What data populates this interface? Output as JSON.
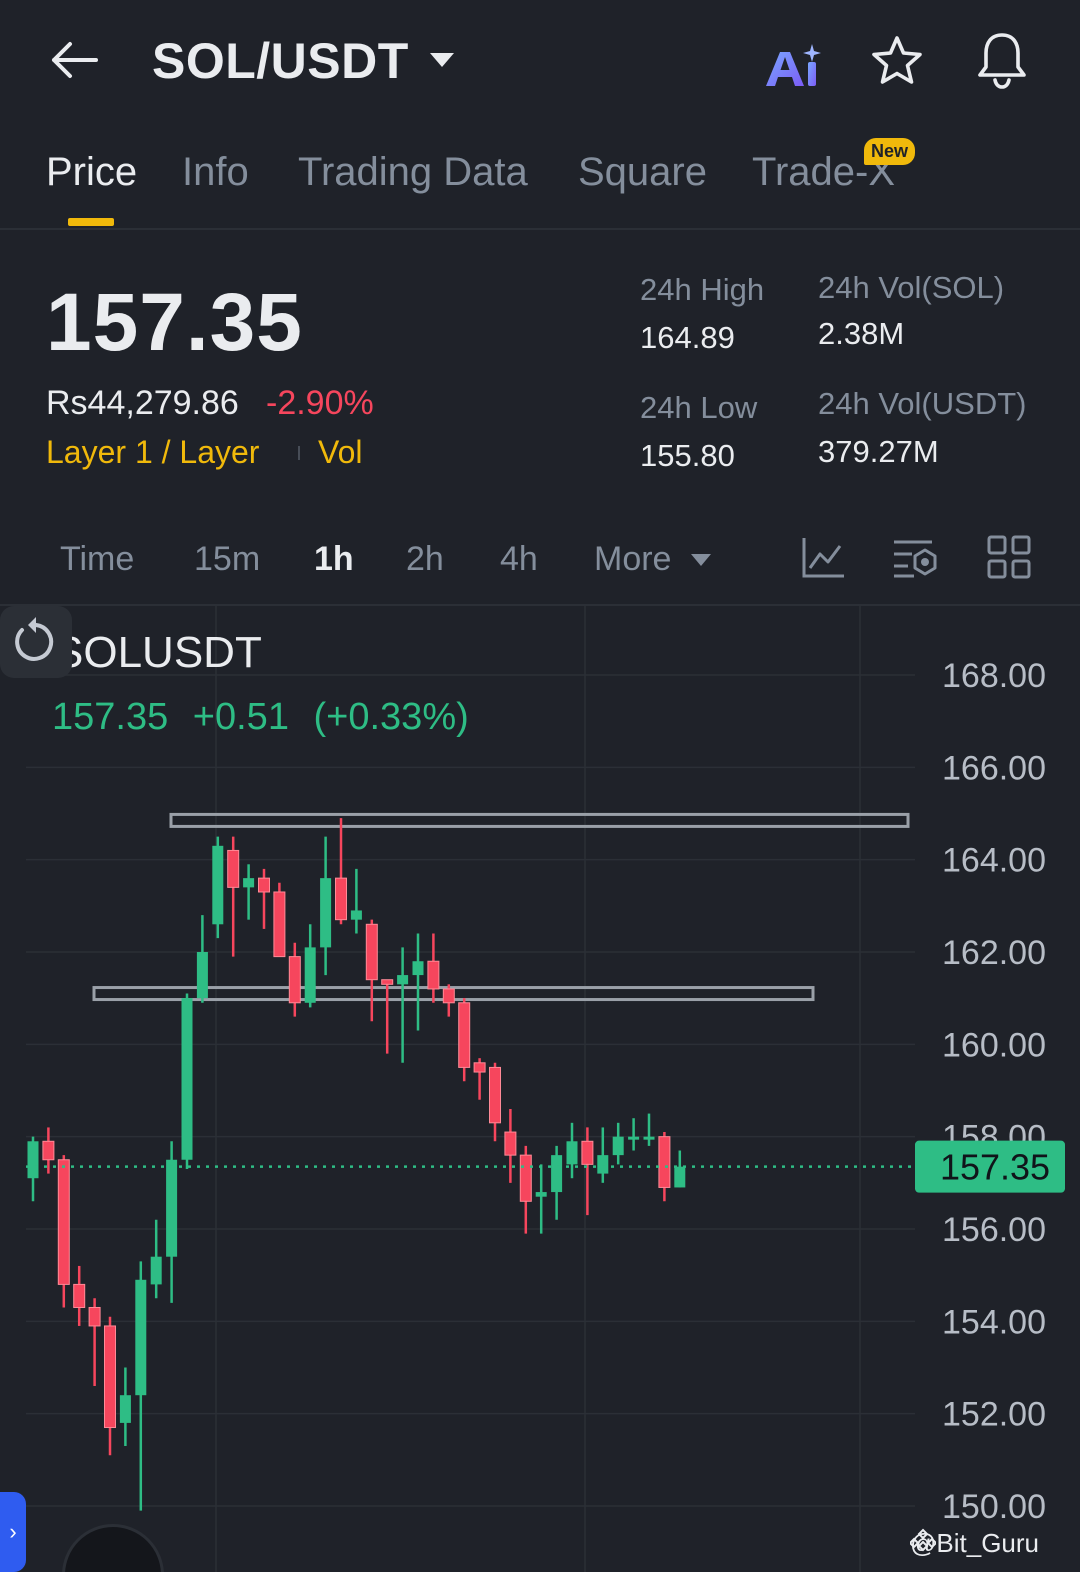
{
  "header": {
    "pair": "SOL/USDT",
    "icons": [
      "back-arrow-icon",
      "chevron-down-icon",
      "ai-icon",
      "star-icon",
      "bell-icon"
    ]
  },
  "tabs": [
    {
      "label": "Price",
      "active": true
    },
    {
      "label": "Info"
    },
    {
      "label": "Trading Data"
    },
    {
      "label": "Square"
    },
    {
      "label": "Trade-X",
      "badge": "New"
    }
  ],
  "ticker": {
    "last_price": "157.35",
    "fiat_price": "Rs44,279.86",
    "change_pct": "-2.90%",
    "tag_category": "Layer 1 / Layer",
    "tag_vol": "Vol",
    "high_label": "24h High",
    "high_value": "164.89",
    "low_label": "24h Low",
    "low_value": "155.80",
    "vol_base_label": "24h Vol(SOL)",
    "vol_base_value": "2.38M",
    "vol_quote_label": "24h Vol(USDT)",
    "vol_quote_value": "379.27M"
  },
  "intervals": {
    "items": [
      "Time",
      "15m",
      "1h",
      "2h",
      "4h"
    ],
    "active": "1h",
    "more_label": "More",
    "tool_icons": [
      "line-chart-icon",
      "indicator-settings-icon",
      "grid-layout-icon"
    ]
  },
  "chart_header": {
    "symbol": "SOLUSDT",
    "price": "157.35",
    "change": "+0.51",
    "change_pct": "(+0.33%)"
  },
  "chart_data": {
    "type": "candlestick",
    "ylim": [
      149.5,
      168.5
    ],
    "y_ticks": [
      "168.00",
      "166.00",
      "164.00",
      "162.00",
      "160.00",
      "158.00",
      "156.00",
      "154.00",
      "152.00",
      "150.00"
    ],
    "last_price_label": "157.35",
    "last_price": 157.35,
    "up_color": "#2ebd85",
    "down_color": "#f6465d",
    "horizontal_levels": [
      {
        "price": 164.85,
        "x_start_index": 10,
        "x_end": "right"
      },
      {
        "price": 161.1,
        "x_start_index": 5,
        "x_end_index": 50
      }
    ],
    "candles": [
      {
        "o": 157.1,
        "h": 158.0,
        "l": 156.6,
        "c": 157.9
      },
      {
        "o": 157.9,
        "h": 158.2,
        "l": 157.2,
        "c": 157.5
      },
      {
        "o": 157.5,
        "h": 157.6,
        "l": 154.3,
        "c": 154.8
      },
      {
        "o": 154.8,
        "h": 155.2,
        "l": 153.9,
        "c": 154.3
      },
      {
        "o": 154.3,
        "h": 154.5,
        "l": 152.6,
        "c": 153.9
      },
      {
        "o": 153.9,
        "h": 154.1,
        "l": 151.1,
        "c": 151.7
      },
      {
        "o": 151.8,
        "h": 153.0,
        "l": 151.3,
        "c": 152.4
      },
      {
        "o": 152.4,
        "h": 155.3,
        "l": 149.9,
        "c": 154.9
      },
      {
        "o": 154.8,
        "h": 156.2,
        "l": 154.5,
        "c": 155.4
      },
      {
        "o": 155.4,
        "h": 157.9,
        "l": 154.4,
        "c": 157.5
      },
      {
        "o": 157.5,
        "h": 161.1,
        "l": 157.3,
        "c": 161.0
      },
      {
        "o": 161.0,
        "h": 162.8,
        "l": 160.9,
        "c": 162.0
      },
      {
        "o": 162.6,
        "h": 164.5,
        "l": 162.3,
        "c": 164.3
      },
      {
        "o": 164.2,
        "h": 164.5,
        "l": 161.9,
        "c": 163.4
      },
      {
        "o": 163.4,
        "h": 163.9,
        "l": 162.7,
        "c": 163.6
      },
      {
        "o": 163.6,
        "h": 163.8,
        "l": 162.5,
        "c": 163.3
      },
      {
        "o": 163.3,
        "h": 163.5,
        "l": 161.9,
        "c": 161.9
      },
      {
        "o": 161.9,
        "h": 162.2,
        "l": 160.6,
        "c": 160.9
      },
      {
        "o": 160.9,
        "h": 162.6,
        "l": 160.8,
        "c": 162.1
      },
      {
        "o": 162.1,
        "h": 164.5,
        "l": 161.5,
        "c": 163.6
      },
      {
        "o": 163.6,
        "h": 164.9,
        "l": 162.6,
        "c": 162.7
      },
      {
        "o": 162.7,
        "h": 163.8,
        "l": 162.4,
        "c": 162.9
      },
      {
        "o": 162.6,
        "h": 162.7,
        "l": 160.5,
        "c": 161.4
      },
      {
        "o": 161.4,
        "h": 161.4,
        "l": 159.8,
        "c": 161.3
      },
      {
        "o": 161.3,
        "h": 162.1,
        "l": 159.6,
        "c": 161.5
      },
      {
        "o": 161.5,
        "h": 162.4,
        "l": 160.3,
        "c": 161.8
      },
      {
        "o": 161.8,
        "h": 162.4,
        "l": 160.9,
        "c": 161.2
      },
      {
        "o": 161.2,
        "h": 161.3,
        "l": 160.6,
        "c": 160.9
      },
      {
        "o": 160.9,
        "h": 161.0,
        "l": 159.2,
        "c": 159.5
      },
      {
        "o": 159.6,
        "h": 159.7,
        "l": 158.8,
        "c": 159.4
      },
      {
        "o": 159.5,
        "h": 159.6,
        "l": 157.9,
        "c": 158.3
      },
      {
        "o": 158.1,
        "h": 158.6,
        "l": 157.0,
        "c": 157.6
      },
      {
        "o": 157.6,
        "h": 157.8,
        "l": 155.9,
        "c": 156.6
      },
      {
        "o": 156.7,
        "h": 157.4,
        "l": 155.9,
        "c": 156.8
      },
      {
        "o": 156.8,
        "h": 157.8,
        "l": 156.2,
        "c": 157.6
      },
      {
        "o": 157.4,
        "h": 158.3,
        "l": 157.1,
        "c": 157.9
      },
      {
        "o": 157.9,
        "h": 158.2,
        "l": 156.3,
        "c": 157.4
      },
      {
        "o": 157.2,
        "h": 158.2,
        "l": 157.0,
        "c": 157.6
      },
      {
        "o": 157.6,
        "h": 158.3,
        "l": 157.4,
        "c": 158.0
      },
      {
        "o": 158.0,
        "h": 158.4,
        "l": 157.7,
        "c": 158.0
      },
      {
        "o": 158.0,
        "h": 158.5,
        "l": 157.8,
        "c": 158.0
      },
      {
        "o": 158.0,
        "h": 158.1,
        "l": 156.6,
        "c": 156.9
      },
      {
        "o": 156.9,
        "h": 157.7,
        "l": 156.9,
        "c": 157.35
      }
    ]
  },
  "footer": {
    "watermark": "@Bit_Guru"
  }
}
